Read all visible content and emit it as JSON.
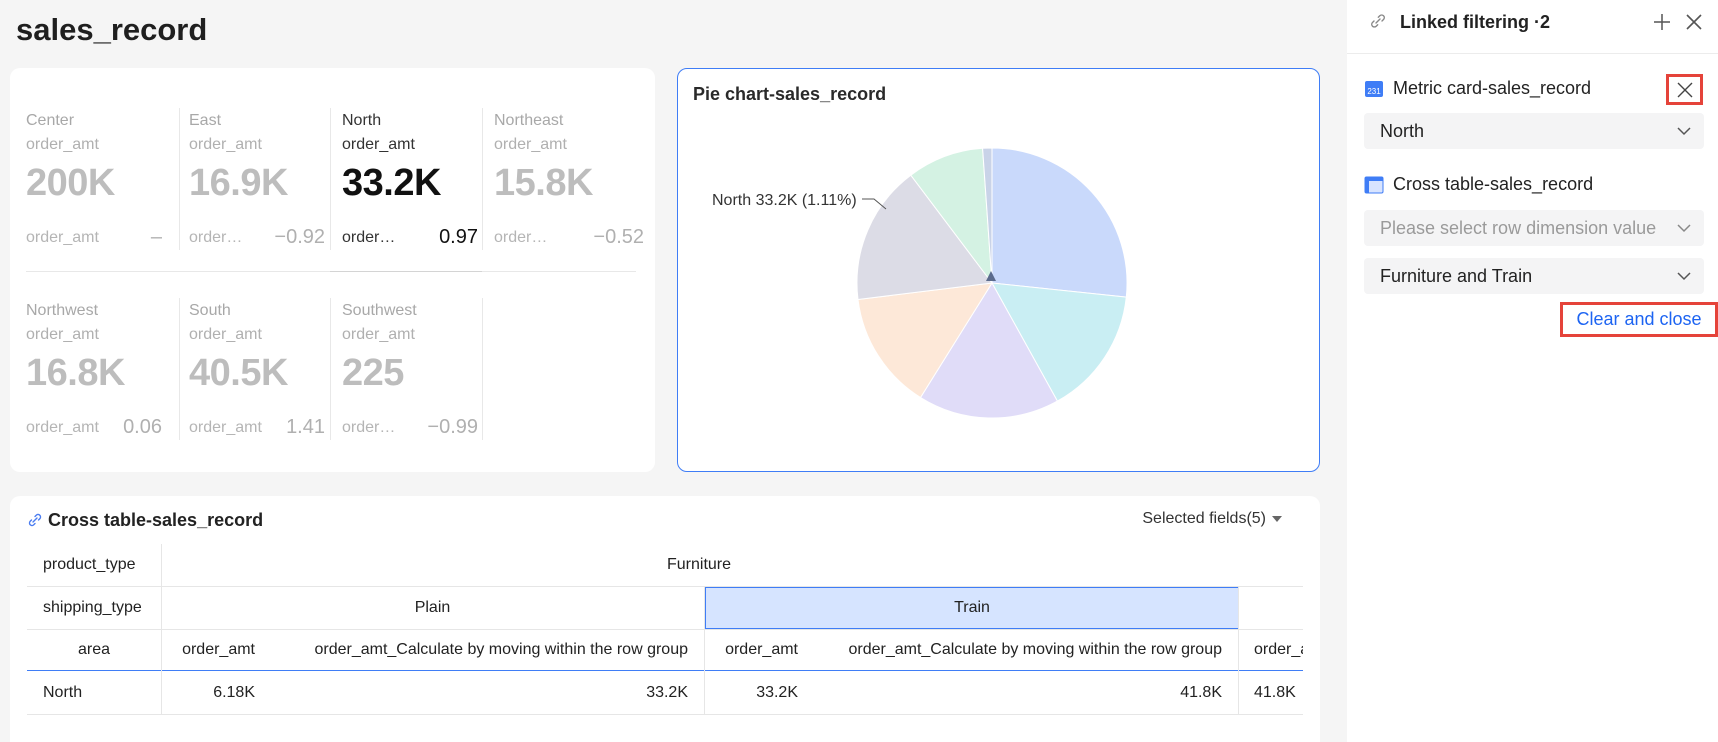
{
  "page": {
    "title": "sales_record"
  },
  "metric_card": {
    "cells": [
      {
        "area": "Center",
        "metric": "order_amt",
        "value": "200K",
        "sub_label": "order_amt",
        "sub_value": "–"
      },
      {
        "area": "East",
        "metric": "order_amt",
        "value": "16.9K",
        "sub_label": "order_amt",
        "sub_value": "−0.92"
      },
      {
        "area": "North",
        "metric": "order_amt",
        "value": "33.2K",
        "sub_label": "order_amt",
        "sub_value": "0.97"
      },
      {
        "area": "Northeast",
        "metric": "order_amt",
        "value": "15.8K",
        "sub_label": "order_amt",
        "sub_value": "−0.52"
      },
      {
        "area": "Northwest",
        "metric": "order_amt",
        "value": "16.8K",
        "sub_label": "order_amt",
        "sub_value": "0.06"
      },
      {
        "area": "South",
        "metric": "order_amt",
        "value": "40.5K",
        "sub_label": "order_amt",
        "sub_value": "1.41"
      },
      {
        "area": "Southwest",
        "metric": "order_amt",
        "value": "225",
        "sub_label": "order_amt",
        "sub_value": "−0.99"
      }
    ],
    "active_index": 2
  },
  "pie_card": {
    "title": "Pie chart-sales_record",
    "label": "North 33.2K (1.11%)",
    "colors": [
      "#c9d9fb",
      "#c9eef3",
      "#e0dcf8",
      "#fde8d8",
      "#dcdce6",
      "#d4f2e3",
      "#c9d3e8"
    ]
  },
  "cross_table": {
    "title": "Cross table-sales_record",
    "selected_fields": "Selected fields(5)",
    "row_headers": {
      "product_type": "product_type",
      "shipping_type": "shipping_type",
      "area": "area"
    },
    "product_type_value": "Furniture",
    "shipping_values": [
      "Plain",
      "Train"
    ],
    "measure_headers": [
      "order_amt",
      "order_amt_Calculate by moving within the row group",
      "order_amt",
      "order_amt_Calculate by moving within the row group",
      "order_amt"
    ],
    "rows": [
      {
        "area": "North",
        "values": [
          "6.18K",
          "33.2K",
          "33.2K",
          "41.8K",
          "41.8K"
        ]
      }
    ]
  },
  "panel": {
    "title": "Linked filtering ·2",
    "groups": [
      {
        "title": "Metric card-sales_record",
        "icon": "metric-card-icon",
        "icon_text": "231",
        "selects": [
          {
            "value": "North",
            "placeholder": false
          }
        ]
      },
      {
        "title": "Cross table-sales_record",
        "icon": "cross-table-icon",
        "selects": [
          {
            "value": "Please select row dimension value",
            "placeholder": true
          },
          {
            "value": "Furniture and Train",
            "placeholder": false
          }
        ]
      }
    ],
    "clear_label": "Clear and close"
  }
}
